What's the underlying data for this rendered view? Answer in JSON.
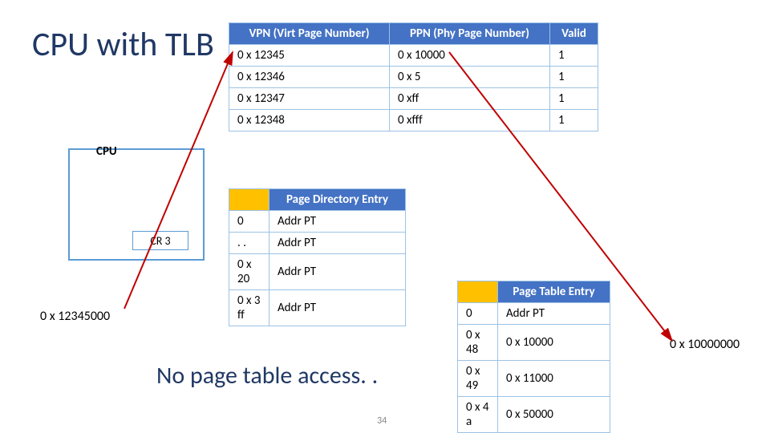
{
  "title": "CPU with TLB",
  "tlb": {
    "headers": [
      "VPN (Virt Page Number)",
      "PPN (Phy Page Number)",
      "Valid"
    ],
    "rows": [
      {
        "vpn": "0 x 12345",
        "ppn": "0 x 10000",
        "valid": "1"
      },
      {
        "vpn": "0 x 12346",
        "ppn": "0 x 5",
        "valid": "1"
      },
      {
        "vpn": "0 x 12347",
        "ppn": "0 xff",
        "valid": "1"
      },
      {
        "vpn": "0 x 12348",
        "ppn": "0 xfff",
        "valid": "1"
      }
    ]
  },
  "cpu": {
    "label": "CPU",
    "cr3": "CR 3",
    "addr": "0 x 12345000"
  },
  "pde": {
    "header": "Page Directory Entry",
    "rows": [
      {
        "k": "0",
        "v": "Addr PT"
      },
      {
        "k": ". .",
        "v": "Addr PT"
      },
      {
        "k": "0 x 20",
        "v": "Addr PT"
      },
      {
        "k": "0 x 3 ff",
        "v": "Addr PT"
      }
    ]
  },
  "pte": {
    "header": "Page Table Entry",
    "rows": [
      {
        "k": "0",
        "v": "Addr PT"
      },
      {
        "k": "0 x 48",
        "v": "0 x 10000"
      },
      {
        "k": "0 x 49",
        "v": "0 x 11000"
      },
      {
        "k": "0 x 4 a",
        "v": "0 x 50000"
      }
    ]
  },
  "no_access": "No page table access. .",
  "result": "0 x 10000000",
  "pagenum": "34"
}
